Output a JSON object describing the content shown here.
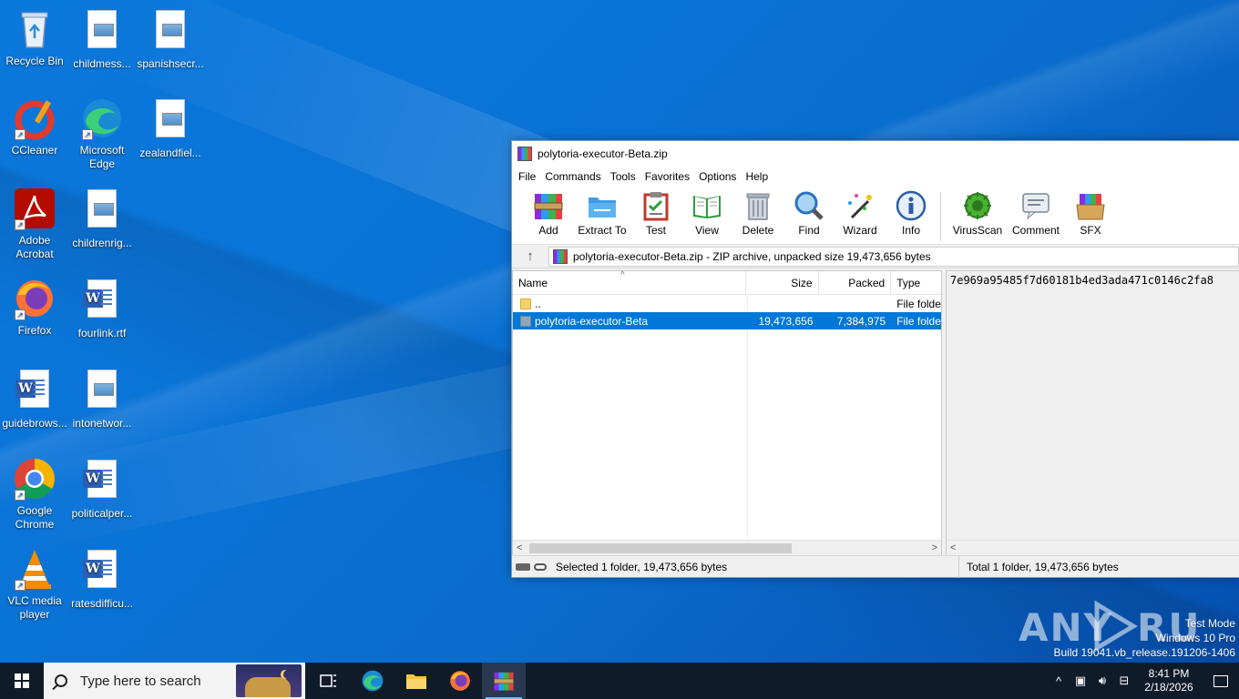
{
  "desktop": {
    "icons": [
      {
        "label": "Recycle Bin",
        "icon": "recycle-bin-icon"
      },
      {
        "label": "childmess...",
        "icon": "image-file-icon"
      },
      {
        "label": "spanishsecr...",
        "icon": "image-file-icon"
      },
      {
        "label": "CCleaner",
        "icon": "ccleaner-icon"
      },
      {
        "label": "Microsoft Edge",
        "icon": "edge-icon"
      },
      {
        "label": "zealandfiel...",
        "icon": "image-file-icon"
      },
      {
        "label": "Adobe Acrobat",
        "icon": "acrobat-icon"
      },
      {
        "label": "childrenrig...",
        "icon": "image-file-icon"
      },
      {
        "label": "Firefox",
        "icon": "firefox-icon"
      },
      {
        "label": "fourlink.rtf",
        "icon": "word-doc-icon"
      },
      {
        "label": "guidebrows...",
        "icon": "word-doc-icon"
      },
      {
        "label": "intonetwor...",
        "icon": "image-file-icon"
      },
      {
        "label": "Google Chrome",
        "icon": "chrome-icon"
      },
      {
        "label": "politicalper...",
        "icon": "word-doc-icon"
      },
      {
        "label": "VLC media player",
        "icon": "vlc-icon"
      },
      {
        "label": "ratesdifficu...",
        "icon": "word-doc-icon"
      }
    ]
  },
  "window": {
    "title": "polytoria-executor-Beta.zip",
    "menu": [
      "File",
      "Commands",
      "Tools",
      "Favorites",
      "Options",
      "Help"
    ],
    "toolbar": {
      "add": "Add",
      "extract": "Extract To",
      "test": "Test",
      "view": "View",
      "delete": "Delete",
      "find": "Find",
      "wizard": "Wizard",
      "info": "Info",
      "virusscan": "VirusScan",
      "comment": "Comment",
      "sfx": "SFX"
    },
    "path": "polytoria-executor-Beta.zip - ZIP archive, unpacked size 19,473,656 bytes",
    "columns": {
      "name": "Name",
      "size": "Size",
      "packed": "Packed",
      "type": "Type"
    },
    "rows": [
      {
        "name": "..",
        "size": "",
        "packed": "",
        "type": "File folder"
      },
      {
        "name": "polytoria-executor-Beta",
        "size": "19,473,656",
        "packed": "7,384,975",
        "type": "File folder"
      }
    ],
    "comment": "7e969a95485f7d60181b4ed3ada471c0146c2fa8",
    "status_left": "Selected 1 folder, 19,473,656 bytes",
    "status_right": "Total 1 folder, 19,473,656 bytes"
  },
  "taskbar": {
    "search_placeholder": "Type here to search",
    "time": "8:41 PM",
    "date": "2/18/2026"
  },
  "watermark": {
    "line1": "Test Mode",
    "line2": "Windows 10 Pro",
    "line3": "Build 19041.vb_release.191206-1406",
    "brand": "ANY RUN"
  },
  "colors": {
    "selection": "#0078d7",
    "taskbar": "#101b2a",
    "desktop": "#0a6fd4"
  }
}
